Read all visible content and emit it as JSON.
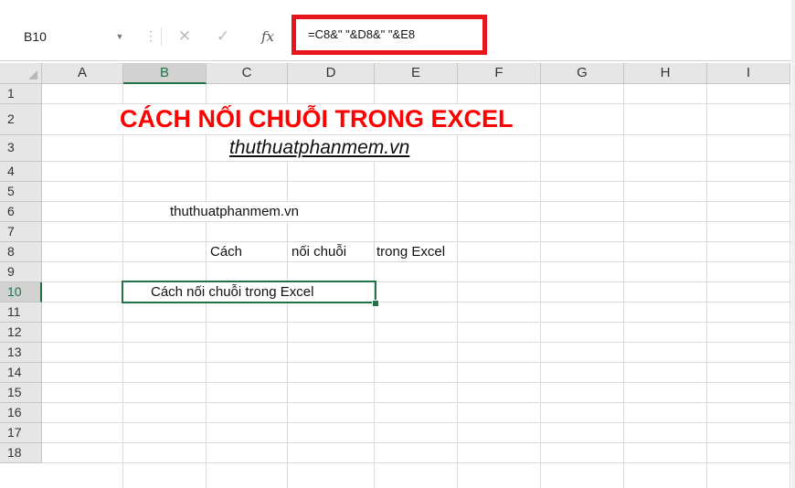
{
  "formula_bar": {
    "name_box": "B10",
    "cancel_icon": "✕",
    "enter_icon": "✓",
    "fx_icon": "fx",
    "formula": "=C8&\" \"&D8&\" \"&E8"
  },
  "columns": [
    "A",
    "B",
    "C",
    "D",
    "E",
    "F",
    "G",
    "H",
    "I"
  ],
  "rows": [
    "1",
    "2",
    "3",
    "4",
    "5",
    "6",
    "7",
    "8",
    "9",
    "10",
    "11",
    "12",
    "13",
    "14",
    "15",
    "16",
    "17",
    "18"
  ],
  "selected_cell": "B10",
  "cells": {
    "B2": "CÁCH NỐI CHUỖI TRONG EXCEL",
    "C3": "thuthuatphanmem.vn",
    "B6": "thuthuatphanmem.vn",
    "C8": "Cách",
    "D8": "nối chuỗi",
    "E8": "trong Excel",
    "B10": "Cách nối chuỗi trong Excel"
  },
  "colors": {
    "title": "#ff0000",
    "highlight": "#e8141c",
    "selection": "#217346"
  }
}
